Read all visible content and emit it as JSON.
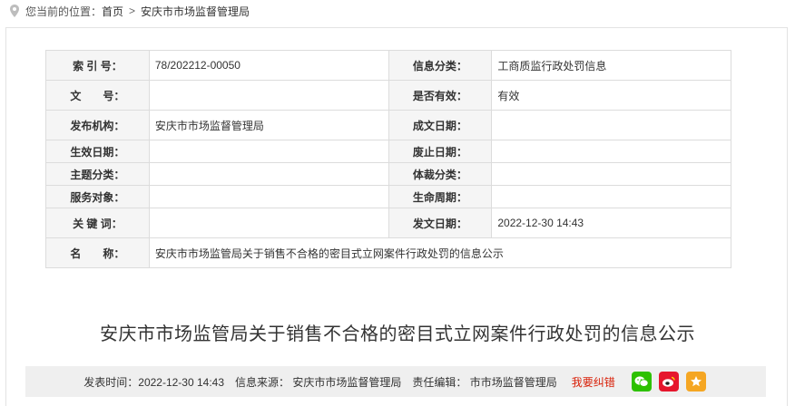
{
  "breadcrumb": {
    "prefix": "您当前的位置：",
    "home": "首页",
    "separator": ">",
    "current": "安庆市市场监督管理局"
  },
  "meta_table": {
    "rows": [
      {
        "l1": "索 引 号：",
        "v1": "78/202212-00050",
        "l2": "信息分类：",
        "v2": "工商质监行政处罚信息"
      },
      {
        "l1": "文　　号：",
        "v1": "",
        "l2": "是否有效：",
        "v2": "有效"
      },
      {
        "l1": "发布机构：",
        "v1": "安庆市市场监督管理局",
        "l2": "成文日期：",
        "v2": ""
      },
      {
        "l1": "生效日期：",
        "v1": "",
        "l2": "废止日期：",
        "v2": ""
      },
      {
        "l1": "主题分类：",
        "v1": "",
        "l2": "体裁分类：",
        "v2": ""
      },
      {
        "l1": "服务对象：",
        "v1": "",
        "l2": "生命周期：",
        "v2": ""
      },
      {
        "l1": "关 键 词：",
        "v1": "",
        "l2": "发文日期：",
        "v2": "2022-12-30 14:43"
      }
    ],
    "name_label": "名　　称：",
    "name_value": "安庆市市场监管局关于销售不合格的密目式立网案件行政处罚的信息公示"
  },
  "article": {
    "title": "安庆市市场监管局关于销售不合格的密目式立网案件行政处罚的信息公示"
  },
  "infobar": {
    "publish_time": "发表时间：2022-12-30 14:43",
    "source": "信息来源： 安庆市市场监督管理局",
    "editor": "责任编辑： 市市场监督管理局",
    "error_link": "我要纠错"
  },
  "share": {
    "icons": [
      "wechat-icon",
      "weibo-icon",
      "favorite-star-icon"
    ],
    "colors": {
      "wechat": "#2dc100",
      "weibo": "#e6162d",
      "favorite": "#f5a623"
    }
  },
  "colors": {
    "error_link": "#d81e06",
    "label_bg": "#f5f5f5",
    "infobar_bg": "#efefef"
  }
}
